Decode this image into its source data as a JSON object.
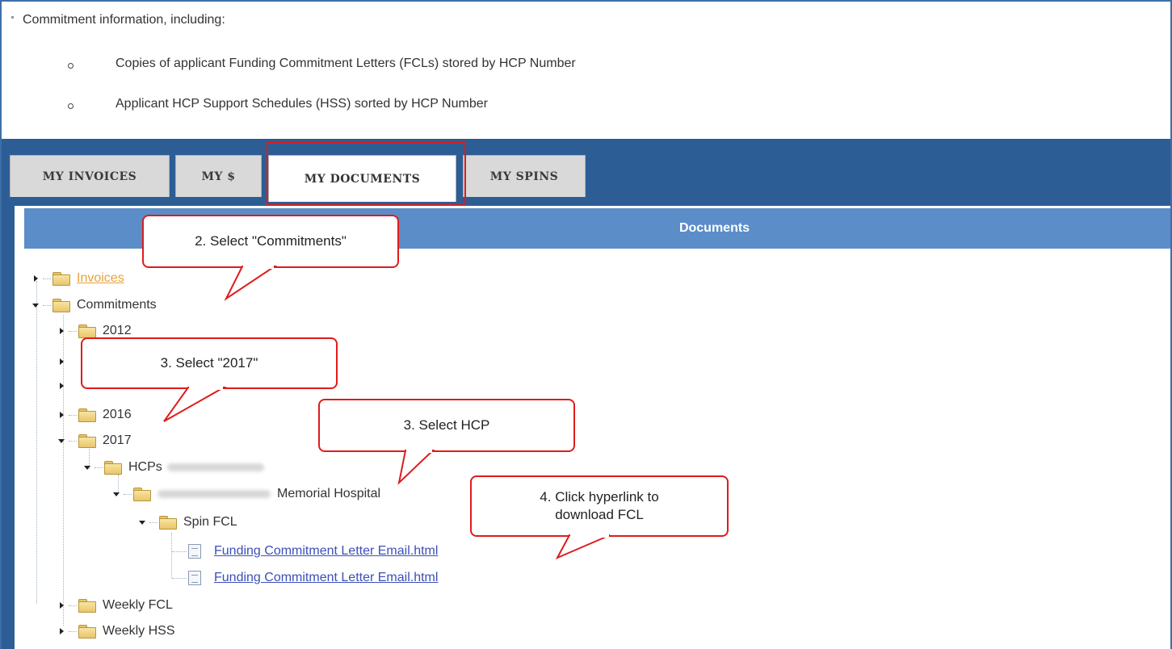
{
  "intro": {
    "heading": "Commitment information, including:",
    "bullets": [
      "Copies of applicant Funding Commitment Letters (FCLs) stored by HCP Number",
      "Applicant HCP Support Schedules (HSS) sorted by HCP Number"
    ]
  },
  "tabs": [
    {
      "label": "MY INVOICES"
    },
    {
      "label": "MY $"
    },
    {
      "label": "MY DOCUMENTS",
      "active": true
    },
    {
      "label": "MY SPINS"
    }
  ],
  "documents_header": "Documents",
  "tree": {
    "invoices": "Invoices",
    "commitments": "Commitments",
    "year_2012": "2012",
    "year_2016": "2016",
    "year_2017": "2017",
    "hcps": "HCPs",
    "hospital": "Memorial Hospital",
    "spin_fcl": "Spin FCL",
    "file_1": "Funding Commitment Letter Email.html",
    "file_2": "Funding Commitment Letter Email.html",
    "weekly_fcl": "Weekly FCL",
    "weekly_hss": "Weekly HSS"
  },
  "callouts": {
    "c1": "2. Select \"Commitments\"",
    "c2": "3. Select \"2017\"",
    "c3": "3. Select HCP",
    "c4_line1": "4. Click hyperlink to",
    "c4_line2": "download FCL"
  },
  "colors": {
    "band": "#2d5d95",
    "header": "#5b8dc8",
    "highlight": "#e01b1b",
    "link": "#3b4fb8",
    "link_visited": "#e8a23a"
  }
}
